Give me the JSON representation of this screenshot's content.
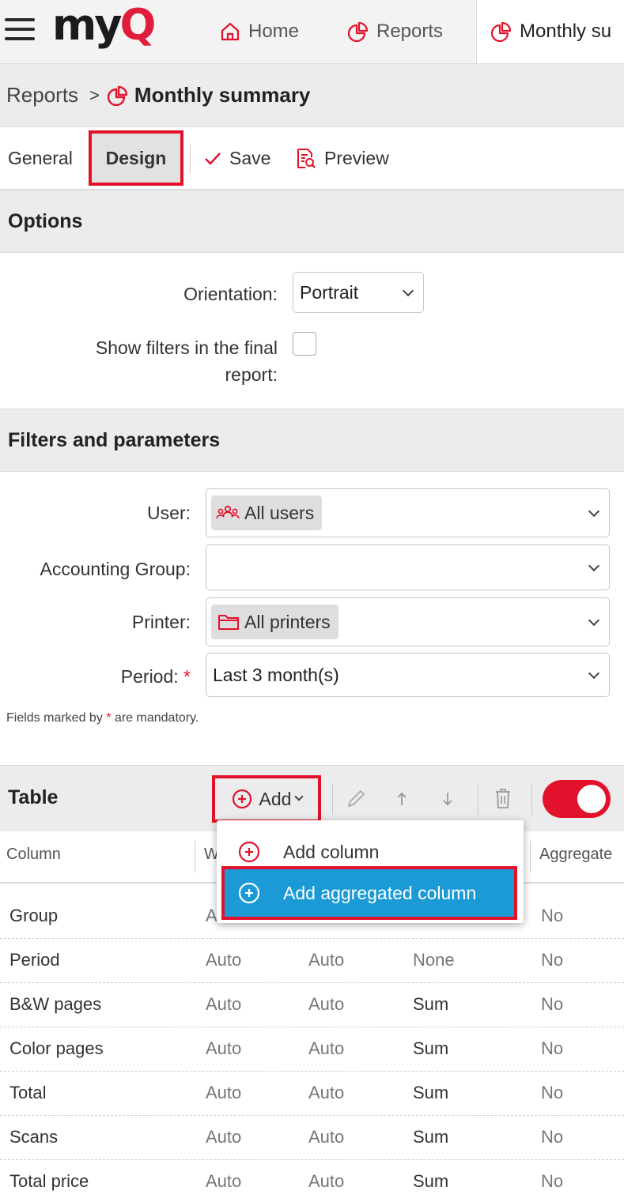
{
  "topbar": {
    "logo_text": "my",
    "logo_q": "Q",
    "tabs": [
      {
        "label": "Home",
        "icon": "home-icon"
      },
      {
        "label": "Reports",
        "icon": "pie-chart-icon"
      },
      {
        "label": "Monthly su",
        "icon": "pie-chart-icon"
      }
    ]
  },
  "breadcrumb": {
    "parent": "Reports",
    "separator": ">",
    "current": "Monthly summary"
  },
  "toolbar": {
    "general_label": "General",
    "design_label": "Design",
    "save_label": "Save",
    "preview_label": "Preview"
  },
  "options": {
    "title": "Options",
    "orientation_label": "Orientation:",
    "orientation_value": "Portrait",
    "show_filters_label_line1": "Show filters in the final",
    "show_filters_label_line2": "report:",
    "show_filters_checked": false
  },
  "filters": {
    "title": "Filters and parameters",
    "user_label": "User:",
    "user_value": "All users",
    "accounting_group_label": "Accounting Group:",
    "accounting_group_value": "",
    "printer_label": "Printer:",
    "printer_value": "All printers",
    "period_label": "Period:",
    "period_required_mark": "*",
    "period_value": "Last 3 month(s)",
    "note_prefix": "Fields marked by ",
    "note_mark": "*",
    "note_suffix": " are mandatory."
  },
  "table": {
    "title": "Table",
    "add_label": "Add",
    "toggle_on": true,
    "columns": [
      "Column",
      "Wi",
      "Aggregate"
    ],
    "rows": [
      {
        "column": "Group",
        "width": "A",
        "c3": "",
        "c4": "",
        "aggregate": "No"
      },
      {
        "column": "Period",
        "width": "Auto",
        "c3": "Auto",
        "c4": "None",
        "aggregate": "No"
      },
      {
        "column": "B&W pages",
        "width": "Auto",
        "c3": "Auto",
        "c4": "Sum",
        "aggregate": "No"
      },
      {
        "column": "Color pages",
        "width": "Auto",
        "c3": "Auto",
        "c4": "Sum",
        "aggregate": "No"
      },
      {
        "column": "Total",
        "width": "Auto",
        "c3": "Auto",
        "c4": "Sum",
        "aggregate": "No"
      },
      {
        "column": "Scans",
        "width": "Auto",
        "c3": "Auto",
        "c4": "Sum",
        "aggregate": "No"
      },
      {
        "column": "Total price",
        "width": "Auto",
        "c3": "Auto",
        "c4": "Sum",
        "aggregate": "No"
      }
    ]
  },
  "add_menu": {
    "items": [
      {
        "label": "Add column",
        "icon": "plus-circle-icon"
      },
      {
        "label": "Add aggregated column",
        "icon": "plus-circle-icon"
      }
    ]
  },
  "colors": {
    "accent_red": "#e3122c",
    "highlight_blue": "#1b9ad6"
  }
}
